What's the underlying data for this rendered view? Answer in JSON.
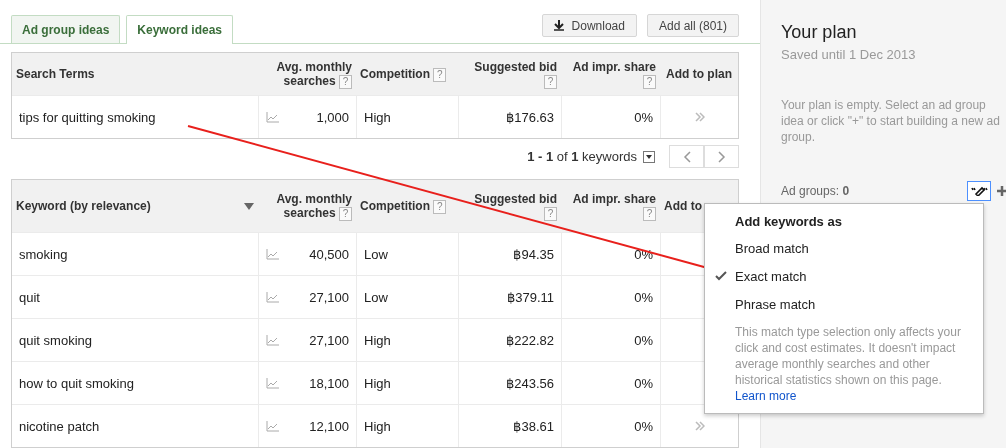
{
  "tabs": [
    {
      "label": "Ad group ideas",
      "selected": false
    },
    {
      "label": "Keyword ideas",
      "selected": true
    }
  ],
  "toolbar": {
    "download": "Download",
    "add_all": "Add all (801)"
  },
  "search_terms": {
    "columns": [
      {
        "label": "Search Terms"
      },
      {
        "label": "Avg. monthly searches",
        "help": "?"
      },
      {
        "label": "Competition",
        "help": "?"
      },
      {
        "label": "Suggested bid",
        "help": "?"
      },
      {
        "label": "Ad impr. share",
        "help": "?"
      },
      {
        "label": "Add to plan"
      }
    ],
    "rows": [
      {
        "term": "tips for quitting smoking",
        "searches": "1,000",
        "competition": "High",
        "bid": "฿176.63",
        "share": "0%"
      }
    ]
  },
  "pagination": "**1 - 1** of **1** keywords",
  "keywords": {
    "columns": [
      {
        "label": "Keyword (by relevance)"
      },
      {
        "label": "Avg. monthly searches",
        "help": "?"
      },
      {
        "label": "Competition",
        "help": "?"
      },
      {
        "label": "Suggested bid",
        "help": "?"
      },
      {
        "label": "Ad impr. share",
        "help": "?"
      },
      {
        "label": "Add to"
      }
    ],
    "rows": [
      {
        "term": "smoking",
        "searches": "40,500",
        "competition": "Low",
        "bid": "฿94.35",
        "share": "0%"
      },
      {
        "term": "quit",
        "searches": "27,100",
        "competition": "Low",
        "bid": "฿379.11",
        "share": "0%"
      },
      {
        "term": "quit smoking",
        "searches": "27,100",
        "competition": "High",
        "bid": "฿222.82",
        "share": "0%"
      },
      {
        "term": "how to quit smoking",
        "searches": "18,100",
        "competition": "High",
        "bid": "฿243.56",
        "share": "0%"
      },
      {
        "term": "nicotine patch",
        "searches": "12,100",
        "competition": "High",
        "bid": "฿38.61",
        "share": "0%"
      }
    ]
  },
  "plan": {
    "title": "Your plan",
    "saved": "Saved until 1 Dec 2013",
    "empty": "Your plan is empty. Select an ad group idea or click \"+\" to start building a new ad group.",
    "ad_groups": "Ad groups: **0**"
  },
  "match_menu": {
    "title": "Add keywords as",
    "options": [
      {
        "label": "Broad match",
        "selected": false
      },
      {
        "label": "Exact match",
        "selected": true
      },
      {
        "label": "Phrase match",
        "selected": false
      }
    ],
    "note": "This match type selection only affects your click and cost estimates. It doesn't impact average monthly searches and other historical statistics shown on this page.",
    "link": "Learn more"
  }
}
